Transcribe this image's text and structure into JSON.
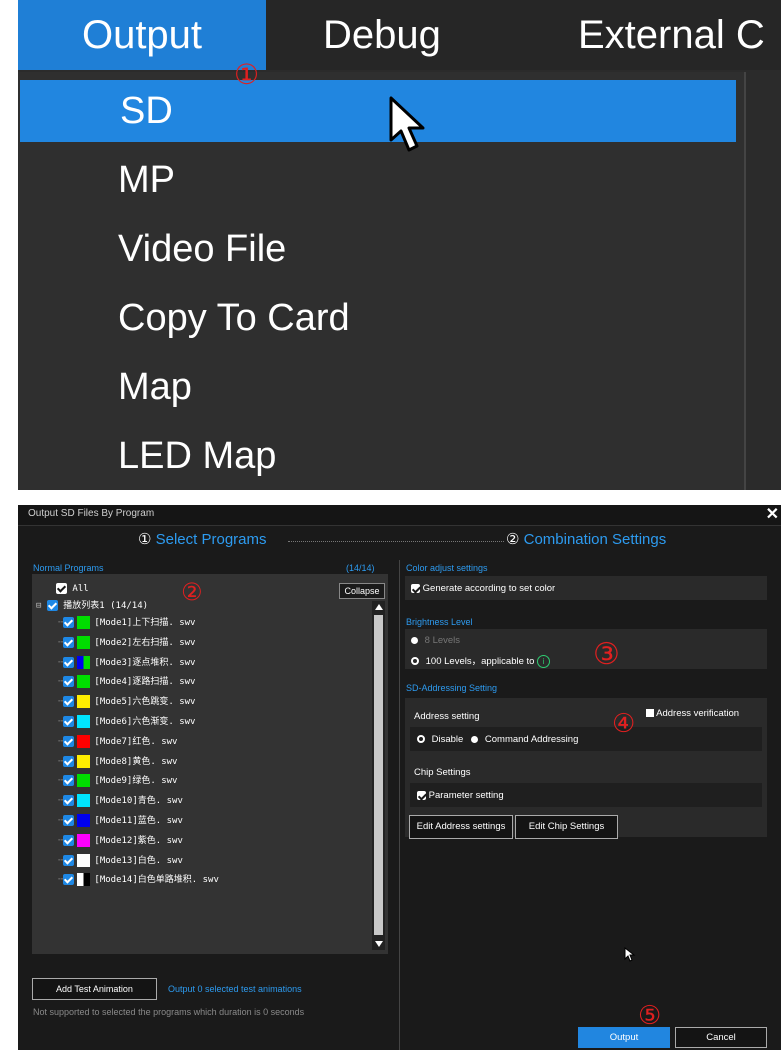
{
  "menubar": {
    "tabs": [
      "Output",
      "Debug",
      "External C"
    ]
  },
  "menu": {
    "items": [
      "SD",
      "MP",
      "Video File",
      "Copy To Card",
      "Map",
      "LED Map"
    ]
  },
  "annotations": {
    "n1": "①",
    "n2": "②",
    "n3": "③",
    "n4": "④",
    "n5": "⑤"
  },
  "dialog": {
    "title": "Output SD Files By Program",
    "close": "✕",
    "steps": [
      {
        "num": "①",
        "label": "Select Programs"
      },
      {
        "num": "②",
        "label": "Combination Settings"
      }
    ],
    "left": {
      "section": "Normal Programs",
      "count": "(14/14)",
      "all_label": "All",
      "collapse": "Collapse",
      "group": "播放列表1 (14/14)",
      "group_toggle": "⊟",
      "programs": [
        {
          "label": "[Mode1]上下扫描. swv",
          "color": "#00dd00"
        },
        {
          "label": "[Mode2]左右扫描. swv",
          "color": "#00dd00"
        },
        {
          "label": "[Mode3]逐点堆积. swv",
          "color": "#0000ee"
        },
        {
          "label": "[Mode4]逐路扫描. swv",
          "color": "#00dd00"
        },
        {
          "label": "[Mode5]六色跳变. swv",
          "color": "#ffee00"
        },
        {
          "label": "[Mode6]六色渐变. swv",
          "color": "#00e5ff"
        },
        {
          "label": "[Mode7]红色. swv",
          "color": "#ff0000"
        },
        {
          "label": "[Mode8]黄色. swv",
          "color": "#ffee00"
        },
        {
          "label": "[Mode9]绿色. swv",
          "color": "#00dd00"
        },
        {
          "label": "[Mode10]青色. swv",
          "color": "#00e5ff"
        },
        {
          "label": "[Mode11]蓝色. swv",
          "color": "#0000ee"
        },
        {
          "label": "[Mode12]紫色. swv",
          "color": "#ff00ff"
        },
        {
          "label": "[Mode13]白色. swv",
          "color": "#ffffff"
        },
        {
          "label": "[Mode14]白色单路堆积. swv",
          "color": "#ffffff"
        }
      ],
      "add_test": "Add Test Animation",
      "test_status": "Output 0 selected test animations",
      "note": "Not supported to selected the programs which duration is 0 seconds"
    },
    "right": {
      "color_section": "Color adjust settings",
      "generate": "Generate according to set color",
      "brightness_section": "Brightness Level",
      "levels_a": "8 Levels",
      "levels_b": "100 Levels，applicable to",
      "info_icon": "i",
      "addr_section": "SD-Addressing Setting",
      "addr_setting": "Address setting",
      "addr_verify": "Address verification",
      "disable": "Disable",
      "command": "Command Addressing",
      "chip_settings": "Chip Settings",
      "param": "Parameter setting",
      "edit_addr": "Edit Address settings",
      "edit_chip": "Edit Chip Settings"
    },
    "output": "Output",
    "cancel": "Cancel"
  }
}
